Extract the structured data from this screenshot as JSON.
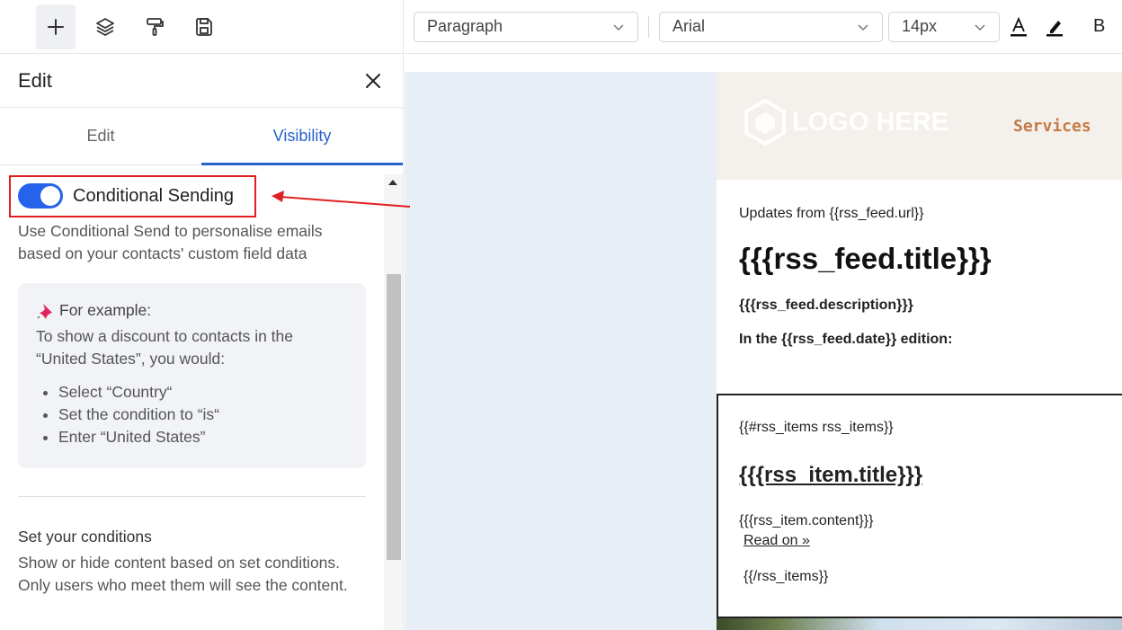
{
  "toolbar": {
    "icons": [
      "plus-icon",
      "layers-icon",
      "paint-roller-icon",
      "save-icon"
    ]
  },
  "panel": {
    "title": "Edit",
    "tabs": [
      {
        "label": "Edit",
        "active": false
      },
      {
        "label": "Visibility",
        "active": true
      }
    ],
    "conditional": {
      "label": "Conditional Sending",
      "enabled": true,
      "description": "Use Conditional Send to personalise emails based on your contacts' custom field data"
    },
    "example": {
      "icon": "📌",
      "heading": "For example:",
      "text": "To show a discount to contacts in the “United States”, you would:",
      "steps": [
        "Select “Country“",
        "Set the condition to “is“",
        "Enter “United States”"
      ]
    },
    "conditions": {
      "title": "Set your conditions",
      "description": "Show or hide content based on set conditions. Only users who meet them will see the content."
    }
  },
  "formatbar": {
    "block_type": "Paragraph",
    "font": "Arial",
    "size": "14px",
    "bold_label": "B"
  },
  "email": {
    "logo_text": "LOGO HERE",
    "nav_link": "Services",
    "updates": "Updates from {{rss_feed.url}}",
    "feed_title": "{{{rss_feed.title}}}",
    "feed_description": "{{{rss_feed.description}}}",
    "feed_date": "In the {{rss_feed.date}} edition:",
    "items_open": "{{#rss_items rss_items}}",
    "item_title": "{{{rss_item.title}}}",
    "item_content": "{{{rss_item.content}}}",
    "read_on": "Read on »",
    "items_close": "{{/rss_items}}"
  },
  "colors": {
    "accent": "#2563c9",
    "toggle": "#2563eb",
    "highlight": "#e02020",
    "services": "#c57b46"
  }
}
